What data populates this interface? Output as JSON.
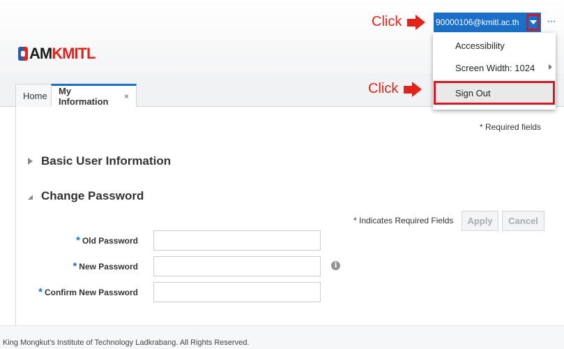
{
  "header": {
    "logo": {
      "prefix": "AM",
      "suffix": "KMITL"
    },
    "user_button_label": "90000106@kmitl.ac.th",
    "more_label": "···",
    "annotation_label": "Click"
  },
  "menu": {
    "items": [
      {
        "label": "Accessibility"
      },
      {
        "label": "Screen Width: 1024"
      },
      {
        "label": "Sign Out"
      }
    ]
  },
  "tabs": [
    {
      "label": "Home"
    },
    {
      "label": "My Information",
      "close": "×"
    }
  ],
  "content": {
    "required_fields_label": "* Required fields",
    "sections": [
      {
        "title": "Basic User Information"
      },
      {
        "title": "Change Password"
      }
    ],
    "indicates_required_label": "* Indicates Required Fields",
    "buttons": {
      "apply": "Apply",
      "cancel": "Cancel"
    },
    "fields": [
      {
        "label": "Old Password"
      },
      {
        "label": "New Password"
      },
      {
        "label": "Confirm New Password"
      }
    ],
    "required_marker": "*",
    "info_icon_glyph": "i"
  },
  "footer": {
    "text": "King Mongkut's Institute of Technology Ladkrabang. All Rights Reserved."
  },
  "colors": {
    "accent": "#1a6fc9",
    "highlight": "#d7161f"
  }
}
